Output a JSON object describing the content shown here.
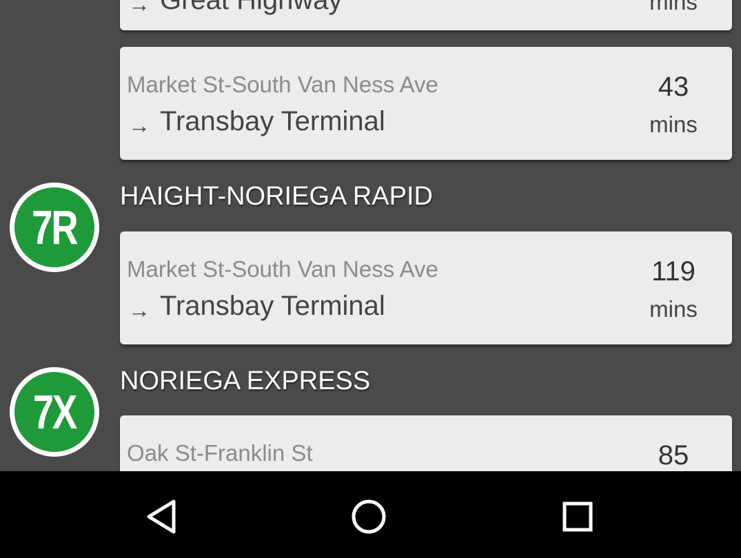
{
  "top_card": {
    "dest_partial": "Great Highway",
    "unit": "mins"
  },
  "cards": [
    {
      "stop": "Market St-South Van Ness Ave",
      "arrow": "→",
      "dest": "Transbay Terminal",
      "time": "43",
      "unit": "mins"
    }
  ],
  "routes": [
    {
      "badge": "7R",
      "badge_color": "#1f9a3a",
      "title": "HAIGHT-NORIEGA RAPID",
      "card": {
        "stop": "Market St-South Van Ness Ave",
        "arrow": "→",
        "dest": "Transbay Terminal",
        "time": "119",
        "unit": "mins"
      }
    },
    {
      "badge": "7X",
      "badge_color": "#1f9a3a",
      "title": "NORIEGA EXPRESS",
      "card": {
        "stop": "Oak St-Franklin St",
        "time": "85"
      }
    }
  ],
  "navbar": {
    "back_icon": "back-triangle-icon",
    "home_icon": "home-circle-icon",
    "recents_icon": "recents-square-icon"
  }
}
